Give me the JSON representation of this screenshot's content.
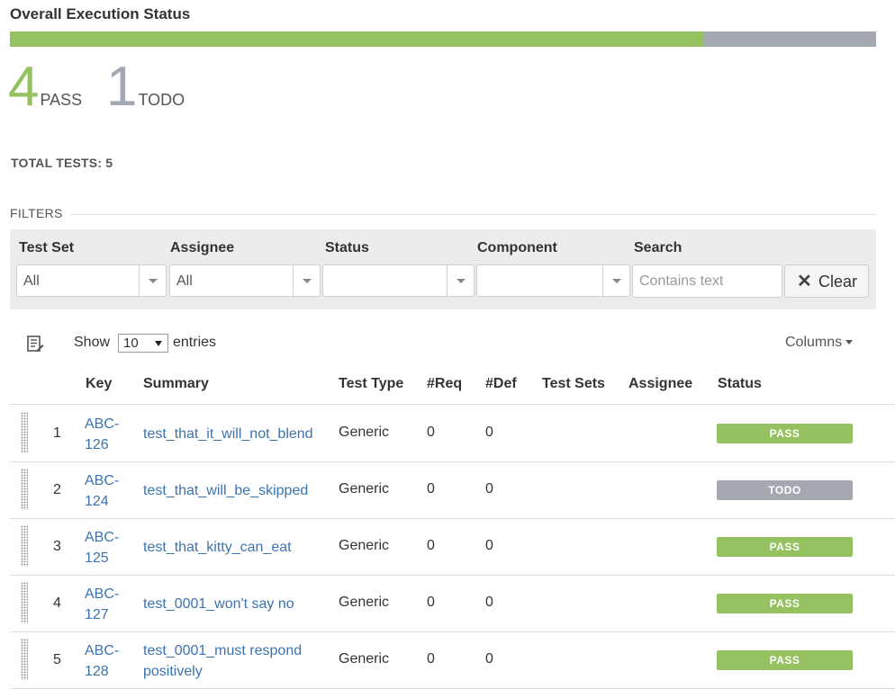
{
  "header": {
    "title": "Overall Execution Status"
  },
  "progress": {
    "pass_fraction": 0.8,
    "todo_fraction": 0.2,
    "pass_color": "#95c160",
    "todo_color": "#a3a8b2"
  },
  "counters": {
    "pass": {
      "count": "4",
      "label": "PASS"
    },
    "todo": {
      "count": "1",
      "label": "TODO"
    }
  },
  "total": "TOTAL TESTS: 5",
  "filters": {
    "heading": "FILTERS",
    "test_set": {
      "label": "Test Set",
      "value": "All"
    },
    "assignee": {
      "label": "Assignee",
      "value": "All"
    },
    "status": {
      "label": "Status",
      "value": ""
    },
    "component": {
      "label": "Component",
      "value": ""
    },
    "search": {
      "label": "Search",
      "placeholder": "Contains text",
      "value": ""
    },
    "clear_label": "Clear"
  },
  "table_controls": {
    "show_label": "Show",
    "entries_value": "10",
    "entries_label": "entries",
    "columns_label": "Columns",
    "export_icon": "export-list-icon"
  },
  "table": {
    "columns": [
      "Key",
      "Summary",
      "Test Type",
      "#Req",
      "#Def",
      "Test Sets",
      "Assignee",
      "Status"
    ],
    "rows": [
      {
        "num": "1",
        "key": "ABC-126",
        "summary": "test_that_it_will_not_blend",
        "type": "Generic",
        "req": "0",
        "def": "0",
        "test_sets": "",
        "assignee": "",
        "status": "PASS",
        "status_color": "#95c160"
      },
      {
        "num": "2",
        "key": "ABC-124",
        "summary": "test_that_will_be_skipped",
        "type": "Generic",
        "req": "0",
        "def": "0",
        "test_sets": "",
        "assignee": "",
        "status": "TODO",
        "status_color": "#a3a8b2"
      },
      {
        "num": "3",
        "key": "ABC-125",
        "summary": "test_that_kitty_can_eat",
        "type": "Generic",
        "req": "0",
        "def": "0",
        "test_sets": "",
        "assignee": "",
        "status": "PASS",
        "status_color": "#95c160"
      },
      {
        "num": "4",
        "key": "ABC-127",
        "summary": "test_0001_won't say no",
        "type": "Generic",
        "req": "0",
        "def": "0",
        "test_sets": "",
        "assignee": "",
        "status": "PASS",
        "status_color": "#95c160"
      },
      {
        "num": "5",
        "key": "ABC-128",
        "summary": "test_0001_must respond positively",
        "type": "Generic",
        "req": "0",
        "def": "0",
        "test_sets": "",
        "assignee": "",
        "status": "PASS",
        "status_color": "#95c160"
      }
    ]
  }
}
